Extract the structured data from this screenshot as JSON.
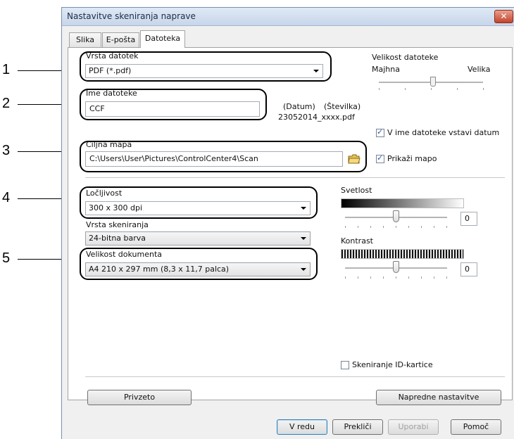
{
  "callouts": [
    "1",
    "2",
    "3",
    "4",
    "5"
  ],
  "window": {
    "title": "Nastavitve skeniranja naprave",
    "close_label": "✕"
  },
  "tabs": [
    {
      "label": "Slika",
      "active": false
    },
    {
      "label": "E-pošta",
      "active": false
    },
    {
      "label": "Datoteka",
      "active": true
    }
  ],
  "file_type": {
    "label": "Vrsta datotek",
    "value": "PDF (*.pdf)"
  },
  "file_size": {
    "label": "Velikost datoteke",
    "min_label": "Majhna",
    "max_label": "Velika"
  },
  "file_name": {
    "label": "Ime datoteke",
    "value": "CCF",
    "date_label": "(Datum)",
    "number_label": "(Številka)",
    "example": "23052014_xxxx.pdf"
  },
  "insert_date": {
    "label": "V ime datoteke vstavi datum",
    "checked": true
  },
  "target_folder": {
    "label": "Ciljna mapa",
    "value": "C:\\Users\\User\\Pictures\\ControlCenter4\\Scan"
  },
  "show_folder": {
    "label": "Prikaži mapo",
    "checked": true
  },
  "resolution": {
    "label": "Ločljivost",
    "value": "300 x 300 dpi"
  },
  "scan_type": {
    "label": "Vrsta skeniranja",
    "value": "24-bitna barva"
  },
  "document_size": {
    "label": "Velikost dokumenta",
    "value": "A4 210 x 297 mm (8,3 x 11,7 palca)"
  },
  "brightness": {
    "label": "Svetlost",
    "value": "0"
  },
  "contrast": {
    "label": "Kontrast",
    "value": "0"
  },
  "id_card_scan": {
    "label": "Skeniranje ID-kartice",
    "checked": false
  },
  "buttons": {
    "default": "Privzeto",
    "advanced": "Napredne nastavitve",
    "ok": "V redu",
    "cancel": "Prekliči",
    "apply": "Uporabi",
    "help": "Pomoč"
  }
}
